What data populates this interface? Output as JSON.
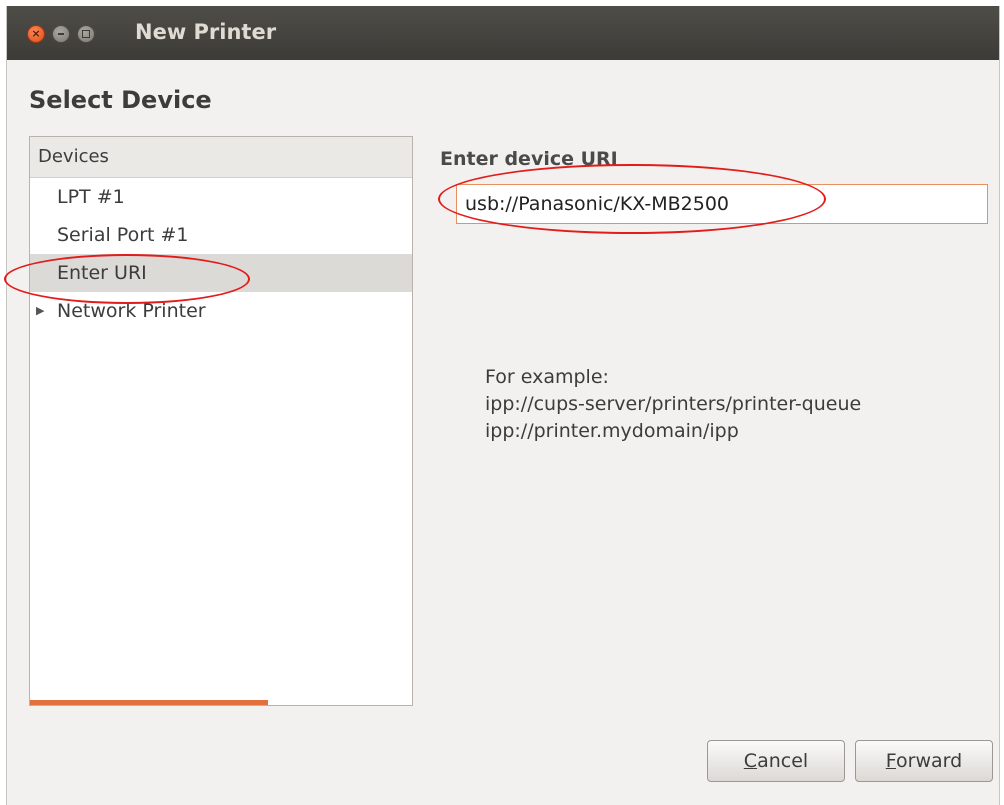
{
  "window": {
    "title": "New Printer",
    "close_glyph": "×"
  },
  "page_title": "Select Device",
  "devices": {
    "header": "Devices",
    "items": [
      {
        "label": "LPT #1",
        "selected": false,
        "expandable": false
      },
      {
        "label": "Serial Port #1",
        "selected": false,
        "expandable": false
      },
      {
        "label": "Enter URI",
        "selected": true,
        "expandable": false
      },
      {
        "label": "Network Printer",
        "selected": false,
        "expandable": true
      }
    ],
    "expander_glyph": "▶"
  },
  "uri": {
    "heading": "Enter device URI",
    "value": "usb://Panasonic/KX-MB2500"
  },
  "example": {
    "line1": "For example:",
    "line2": "ipp://cups-server/printers/printer-queue",
    "line3": "ipp://printer.mydomain/ipp"
  },
  "buttons": {
    "cancel": {
      "mnemonic": "C",
      "rest": "ancel"
    },
    "forward": {
      "mnemonic": "F",
      "rest": "orward"
    }
  },
  "colors": {
    "accent": "#e1703d",
    "annotation": "#e31b1b",
    "titlebar": "#3c3b37"
  }
}
